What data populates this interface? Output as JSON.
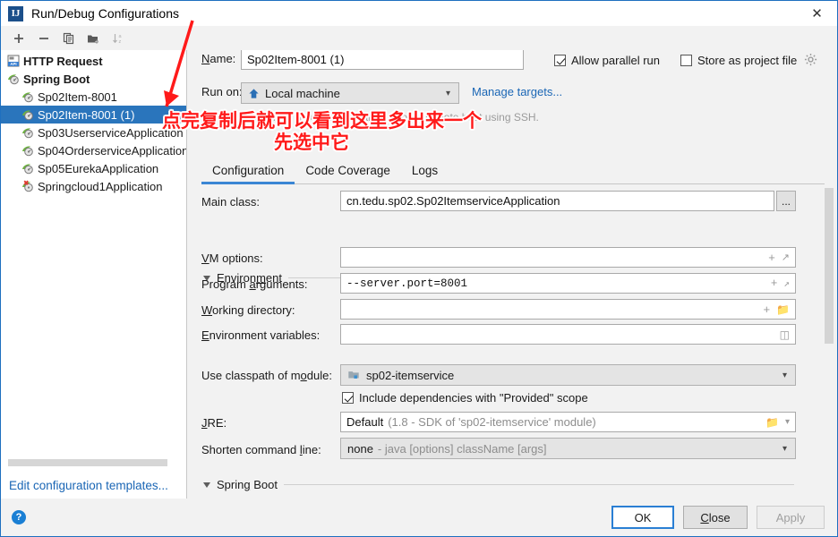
{
  "window": {
    "title": "Run/Debug Configurations",
    "app_icon": "IJ",
    "close_icon": "✕"
  },
  "toolbar": {
    "items": [
      {
        "name": "add-configuration-button",
        "icon": "plus-icon"
      },
      {
        "name": "remove-configuration-button",
        "icon": "minus-icon"
      },
      {
        "name": "copy-configuration-button",
        "icon": "copy-icon"
      },
      {
        "name": "new-folder-button",
        "icon": "folder-add-icon"
      },
      {
        "name": "sort-configurations-button",
        "icon": "sort-alpha-icon"
      }
    ]
  },
  "sidebar": {
    "items": [
      {
        "label": "HTTP Request",
        "icon": "api-icon",
        "type": "group",
        "selected": false
      },
      {
        "label": "Spring Boot",
        "icon": "spring-boot-icon",
        "type": "group",
        "selected": false
      },
      {
        "label": "Sp02Item-8001",
        "icon": "spring-boot-icon",
        "type": "child",
        "selected": false
      },
      {
        "label": "Sp02Item-8001 (1)",
        "icon": "spring-boot-icon",
        "type": "child",
        "selected": true
      },
      {
        "label": "Sp03UserserviceApplication",
        "icon": "spring-boot-icon",
        "type": "child",
        "selected": false
      },
      {
        "label": "Sp04OrderserviceApplication",
        "icon": "spring-boot-icon",
        "type": "child",
        "selected": false
      },
      {
        "label": "Sp05EurekaApplication",
        "icon": "spring-boot-icon",
        "type": "child",
        "selected": false
      },
      {
        "label": "Springcloud1Application",
        "icon": "spring-boot-error-icon",
        "type": "child",
        "selected": false
      }
    ],
    "edit_templates_link": "Edit configuration templates..."
  },
  "form": {
    "name_label": "Name:",
    "name_value": "Sp02Item-8001 (1)",
    "allow_parallel_run_label": "Allow parallel run",
    "allow_parallel_run_checked": true,
    "store_as_project_file_label": "Store as project file",
    "store_as_project_file_checked": false,
    "gear_icon": "gear-icon",
    "run_on_label": "Run on:",
    "run_on_value": "Local machine",
    "run_on_icon": "home-icon",
    "manage_targets_link": "Manage targets...",
    "hint_text": "example in a Docker container or on a remote host using SSH."
  },
  "tabs": [
    {
      "label": "Configuration",
      "active": true
    },
    {
      "label": "Code Coverage",
      "active": false
    },
    {
      "label": "Logs",
      "active": false
    }
  ],
  "configuration": {
    "main_class_label": "Main class:",
    "main_class_value": "cn.tedu.sp02.Sp02ItemserviceApplication",
    "browse_button": "...",
    "environment_section": "Environment",
    "vm_options_label": "VM options:",
    "vm_options_value": "",
    "program_arguments_label": "Program arguments:",
    "program_arguments_value": "--server.port=8001",
    "working_directory_label": "Working directory:",
    "working_directory_value": "",
    "environment_variables_label": "Environment variables:",
    "environment_variables_value": "",
    "use_classpath_label": "Use classpath of module:",
    "use_classpath_value": "sp02-itemservice",
    "use_classpath_icon": "module-icon",
    "include_provided_label": "Include dependencies with \"Provided\" scope",
    "include_provided_checked": true,
    "jre_label": "JRE:",
    "jre_value": "Default",
    "jre_hint": "(1.8 - SDK of 'sp02-itemservice' module)",
    "shorten_cmd_label": "Shorten command line:",
    "shorten_cmd_value": "none",
    "shorten_cmd_hint": "- java [options] className [args]",
    "spring_boot_section": "Spring Boot"
  },
  "footer": {
    "help_icon": "?",
    "ok_label": "OK",
    "close_label": "Close",
    "apply_label": "Apply",
    "apply_disabled": true
  },
  "annotation": {
    "line1": "点完复制后就可以看到这里多出来一个",
    "line2": "先选中它",
    "color": "#ff1a1a",
    "arrow": "red-arrow-icon"
  }
}
